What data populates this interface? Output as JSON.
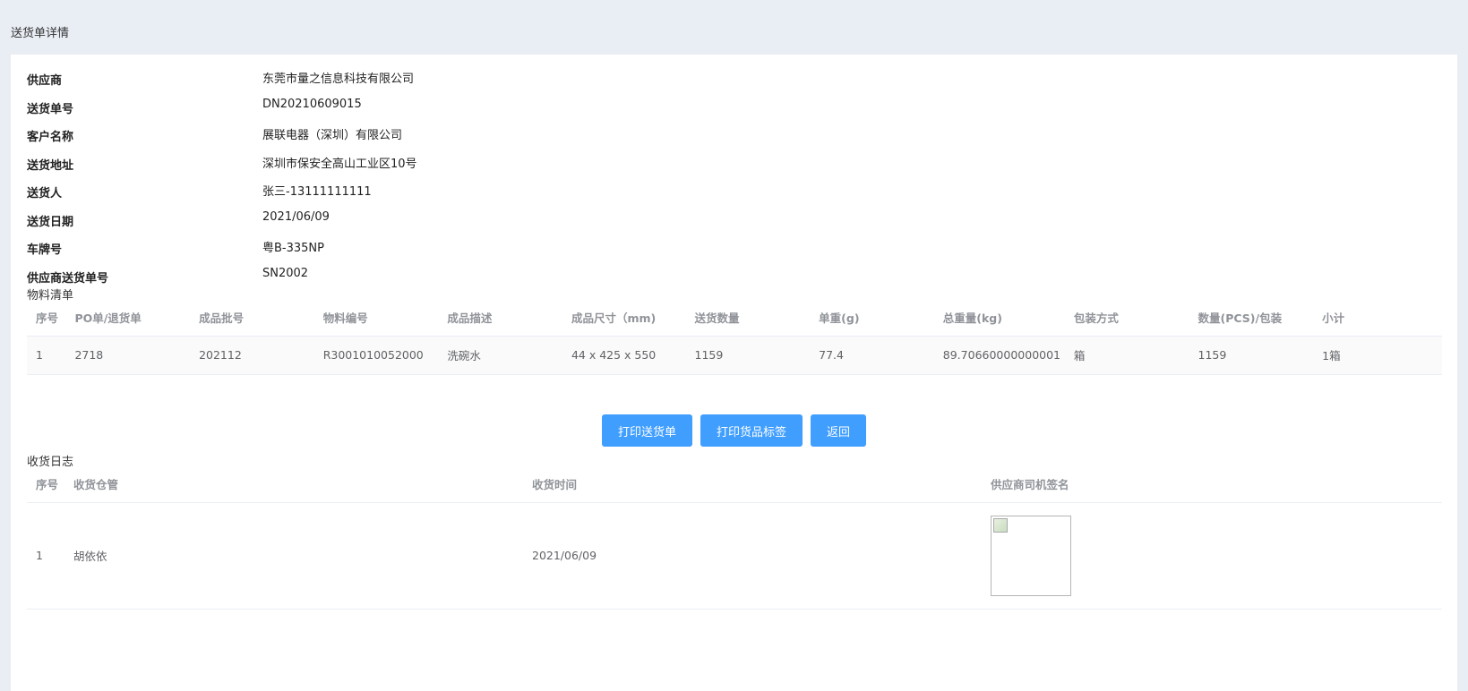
{
  "page": {
    "title": "送货单详情"
  },
  "info": [
    {
      "label": "供应商",
      "value": "东莞市量之信息科技有限公司"
    },
    {
      "label": "送货单号",
      "value": "DN20210609015"
    },
    {
      "label": "客户名称",
      "value": "展联电器（深圳）有限公司"
    },
    {
      "label": "送货地址",
      "value": "深圳市保安全高山工业区10号"
    },
    {
      "label": "送货人",
      "value": "张三-13111111111"
    },
    {
      "label": "送货日期",
      "value": "2021/06/09"
    },
    {
      "label": "车牌号",
      "value": "粤B-335NP"
    },
    {
      "label": "供应商送货单号",
      "value": "SN2002"
    }
  ],
  "materials": {
    "title": "物料清单",
    "columns": [
      "序号",
      "PO单/退货单",
      "成品批号",
      "物料编号",
      "成品描述",
      "成品尺寸（mm)",
      "送货数量",
      "单重(g)",
      "总重量(kg)",
      "包装方式",
      "数量(PCS)/包装",
      "小计"
    ],
    "rows": [
      [
        "1",
        "2718",
        "202112",
        "R3001010052000",
        "洗碗水",
        "44 x 425 x 550",
        "1159",
        "77.4",
        "89.70660000000001",
        "箱",
        "1159",
        "1箱"
      ]
    ]
  },
  "buttons": {
    "print_delivery": "打印送货单",
    "print_label": "打印货品标签",
    "back": "返回"
  },
  "receipt_log": {
    "title": "收货日志",
    "columns": [
      "序号",
      "收货仓管",
      "收货时间",
      "供应商司机签名"
    ],
    "rows": [
      [
        "1",
        "胡依依",
        "2021/06/09"
      ]
    ]
  }
}
